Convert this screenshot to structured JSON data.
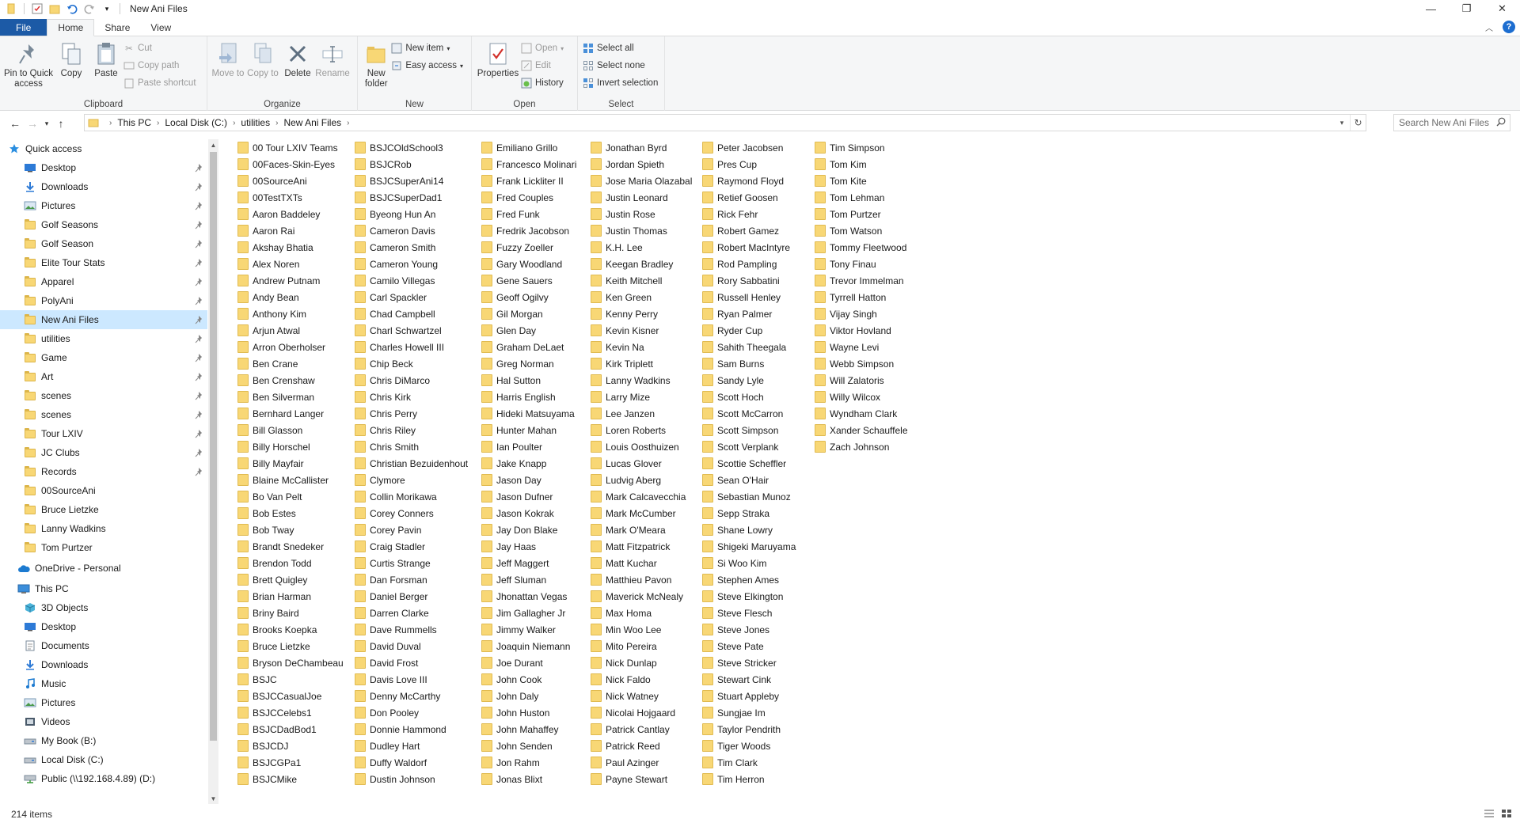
{
  "window": {
    "title": "New Ani Files",
    "controls": {
      "minimize": "—",
      "maximize": "❐",
      "close": "✕"
    }
  },
  "tabs": [
    {
      "label": "File"
    },
    {
      "label": "Home"
    },
    {
      "label": "Share"
    },
    {
      "label": "View"
    }
  ],
  "ribbon": {
    "clipboard": {
      "label": "Clipboard",
      "pin": "Pin to Quick access",
      "copy": "Copy",
      "paste": "Paste",
      "cut": "Cut",
      "copy_path": "Copy path",
      "paste_shortcut": "Paste shortcut"
    },
    "organize": {
      "label": "Organize",
      "move_to": "Move to",
      "copy_to": "Copy to",
      "delete": "Delete",
      "rename": "Rename"
    },
    "new": {
      "label": "New",
      "new_folder": "New folder",
      "new_item": "New item",
      "easy_access": "Easy access"
    },
    "open": {
      "label": "Open",
      "properties": "Properties",
      "open": "Open",
      "edit": "Edit",
      "history": "History"
    },
    "select": {
      "label": "Select",
      "select_all": "Select all",
      "select_none": "Select none",
      "invert_selection": "Invert selection"
    }
  },
  "address": {
    "breadcrumbs": [
      "This PC",
      "Local Disk (C:)",
      "utilities",
      "New Ani Files"
    ],
    "search_placeholder": "Search New Ani Files"
  },
  "nav": {
    "quick_access": "Quick access",
    "quick_items": [
      "Desktop",
      "Downloads",
      "Pictures",
      "Golf Seasons",
      "Golf Season",
      "Elite Tour Stats",
      "Apparel",
      "PolyAni",
      "New Ani Files",
      "utilities",
      "Game",
      "Art",
      "scenes",
      "scenes",
      "Tour LXIV",
      "JC Clubs",
      "Records",
      "00SourceAni",
      "Bruce Lietzke",
      "Lanny Wadkins",
      "Tom Purtzer"
    ],
    "onedrive": "OneDrive - Personal",
    "this_pc": "This PC",
    "pc_items": [
      "3D Objects",
      "Desktop",
      "Documents",
      "Downloads",
      "Music",
      "Pictures",
      "Videos",
      "My Book (B:)",
      "Local Disk (C:)",
      "Public (\\\\192.168.4.89) (D:)"
    ]
  },
  "files": {
    "columns": [
      [
        "00 Tour LXIV Teams",
        "00Faces-Skin-Eyes",
        "00SourceAni",
        "00TestTXTs",
        "Aaron Baddeley",
        "Aaron Rai",
        "Akshay Bhatia",
        "Alex Noren",
        "Andrew Putnam",
        "Andy Bean",
        "Anthony Kim",
        "Arjun Atwal",
        "Arron Oberholser",
        "Ben Crane",
        "Ben Crenshaw",
        "Ben Silverman",
        "Bernhard Langer",
        "Bill Glasson",
        "Billy Horschel",
        "Billy Mayfair",
        "Blaine McCallister",
        "Bo Van Pelt",
        "Bob Estes",
        "Bob Tway",
        "Brandt Snedeker",
        "Brendon Todd",
        "Brett Quigley",
        "Brian Harman",
        "Briny Baird",
        "Brooks Koepka",
        "Bruce Lietzke",
        "Bryson DeChambeau",
        "BSJC",
        "BSJCCasualJoe",
        "BSJCCelebs1",
        "BSJCDadBod1",
        "BSJCDJ",
        "BSJCGPa1",
        "BSJCMike"
      ],
      [
        "BSJCOldSchool3",
        "BSJCRob",
        "BSJCSuperAni14",
        "BSJCSuperDad1",
        "Byeong Hun An",
        "Cameron Davis",
        "Cameron Smith",
        "Cameron Young",
        "Camilo Villegas",
        "Carl Spackler",
        "Chad Campbell",
        "Charl Schwartzel",
        "Charles Howell III",
        "Chip Beck",
        "Chris DiMarco",
        "Chris Kirk",
        "Chris Perry",
        "Chris Riley",
        "Chris Smith",
        "Christian Bezuidenhout",
        "Clymore",
        "Collin Morikawa",
        "Corey Conners",
        "Corey Pavin",
        "Craig Stadler",
        "Curtis Strange",
        "Dan Forsman",
        "Daniel Berger",
        "Darren Clarke",
        "Dave Rummells",
        "David Duval",
        "David Frost",
        "Davis Love III",
        "Denny McCarthy",
        "Don Pooley",
        "Donnie Hammond",
        "Dudley Hart",
        "Duffy Waldorf",
        "Dustin Johnson"
      ],
      [
        "Emiliano Grillo",
        "Francesco Molinari",
        "Frank Lickliter II",
        "Fred Couples",
        "Fred Funk",
        "Fredrik Jacobson",
        "Fuzzy Zoeller",
        "Gary Woodland",
        "Gene Sauers",
        "Geoff Ogilvy",
        "Gil Morgan",
        "Glen Day",
        "Graham DeLaet",
        "Greg Norman",
        "Hal Sutton",
        "Harris English",
        "Hideki Matsuyama",
        "Hunter Mahan",
        "Ian Poulter",
        "Jake Knapp",
        "Jason Day",
        "Jason Dufner",
        "Jason Kokrak",
        "Jay Don Blake",
        "Jay Haas",
        "Jeff Maggert",
        "Jeff Sluman",
        "Jhonattan Vegas",
        "Jim Gallagher Jr",
        "Jimmy Walker",
        "Joaquin Niemann",
        "Joe Durant",
        "John Cook",
        "John Daly",
        "John Huston",
        "John Mahaffey",
        "John Senden",
        "Jon Rahm",
        "Jonas Blixt"
      ],
      [
        "Jonathan Byrd",
        "Jordan Spieth",
        "Jose Maria Olazabal",
        "Justin Leonard",
        "Justin Rose",
        "Justin Thomas",
        "K.H. Lee",
        "Keegan Bradley",
        "Keith Mitchell",
        "Ken Green",
        "Kenny Perry",
        "Kevin Kisner",
        "Kevin Na",
        "Kirk Triplett",
        "Lanny Wadkins",
        "Larry Mize",
        "Lee Janzen",
        "Loren Roberts",
        "Louis Oosthuizen",
        "Lucas Glover",
        "Ludvig Aberg",
        "Mark Calcavecchia",
        "Mark McCumber",
        "Mark O'Meara",
        "Matt Fitzpatrick",
        "Matt Kuchar",
        "Matthieu Pavon",
        "Maverick McNealy",
        "Max Homa",
        "Min Woo Lee",
        "Mito Pereira",
        "Nick Dunlap",
        "Nick Faldo",
        "Nick Watney",
        "Nicolai Hojgaard",
        "Patrick Cantlay",
        "Patrick Reed",
        "Paul Azinger",
        "Payne Stewart"
      ],
      [
        "Peter Jacobsen",
        "Pres Cup",
        "Raymond Floyd",
        "Retief Goosen",
        "Rick Fehr",
        "Robert Gamez",
        "Robert MacIntyre",
        "Rod Pampling",
        "Rory Sabbatini",
        "Russell Henley",
        "Ryan Palmer",
        "Ryder Cup",
        "Sahith Theegala",
        "Sam Burns",
        "Sandy Lyle",
        "Scott Hoch",
        "Scott McCarron",
        "Scott Simpson",
        "Scott Verplank",
        "Scottie Scheffler",
        "Sean O'Hair",
        "Sebastian Munoz",
        "Sepp Straka",
        "Shane Lowry",
        "Shigeki Maruyama",
        "Si Woo Kim",
        "Stephen Ames",
        "Steve Elkington",
        "Steve Flesch",
        "Steve Jones",
        "Steve Pate",
        "Steve Stricker",
        "Stewart Cink",
        "Stuart Appleby",
        "Sungjae Im",
        "Taylor Pendrith",
        "Tiger Woods",
        "Tim Clark",
        "Tim Herron"
      ],
      [
        "Tim Simpson",
        "Tom Kim",
        "Tom Kite",
        "Tom Lehman",
        "Tom Purtzer",
        "Tom Watson",
        "Tommy Fleetwood",
        "Tony Finau",
        "Trevor Immelman",
        "Tyrrell Hatton",
        "Vijay Singh",
        "Viktor Hovland",
        "Wayne Levi",
        "Webb Simpson",
        "Will Zalatoris",
        "Willy Wilcox",
        "Wyndham Clark",
        "Xander Schauffele",
        "Zach Johnson"
      ]
    ]
  },
  "status": {
    "item_count": "214 items"
  },
  "colors": {
    "file_tab": "#1c5aa6",
    "folder": "#f8d775",
    "selected": "#cce8ff",
    "accent": "#0078d7"
  }
}
